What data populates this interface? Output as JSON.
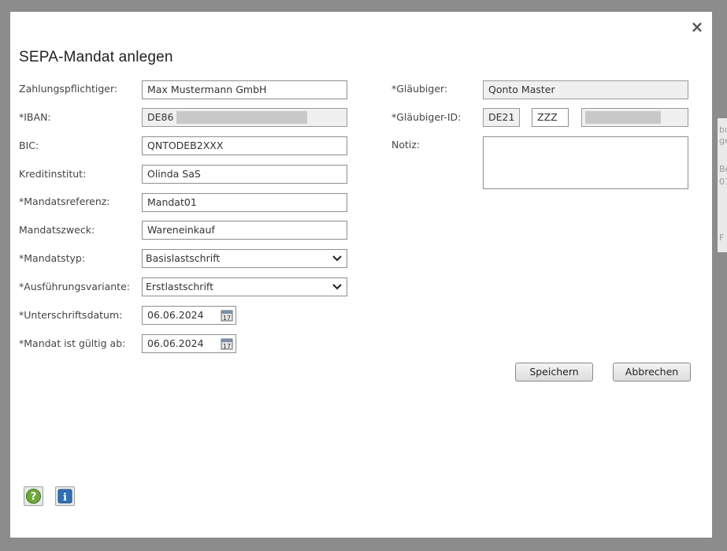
{
  "dialog": {
    "title": "SEPA-Mandat anlegen",
    "close_label": "×"
  },
  "left": {
    "payer_label": "Zahlungspflichtiger:",
    "payer_value": "Max Mustermann GmbH",
    "iban_label": "*IBAN:",
    "iban_prefix": "DE86",
    "bic_label": "BIC:",
    "bic_value": "QNTODEB2XXX",
    "bank_label": "Kreditinstitut:",
    "bank_value": "Olinda SaS",
    "mandate_ref_label": "*Mandatsreferenz:",
    "mandate_ref_value": "Mandat01",
    "purpose_label": "Mandatszweck:",
    "purpose_value": "Wareneinkauf",
    "type_label": "*Mandatstyp:",
    "type_value": "Basislastschrift",
    "variant_label": "*Ausführungsvariante:",
    "variant_value": "Erstlastschrift",
    "signature_date_label": "*Unterschriftsdatum:",
    "signature_date_value": "06.06.2024",
    "valid_from_label": "*Mandat ist gültig ab:",
    "valid_from_value": "06.06.2024"
  },
  "right": {
    "creditor_label": "*Gläubiger:",
    "creditor_value": "Qonto Master",
    "creditor_id_label": "*Gläubiger-ID:",
    "creditor_id_country": "DE21",
    "creditor_id_zzz": "ZZZ",
    "note_label": "Notiz:"
  },
  "actions": {
    "save_label": "Speichern",
    "cancel_label": "Abbrechen"
  },
  "footer": {
    "help_icon": "help-icon",
    "info_icon": "info-icon"
  },
  "background": {
    "fragments": [
      "bı",
      "ge",
      "Be",
      "01",
      "F"
    ]
  },
  "colors": {
    "overlay": "#8c8c8c",
    "readonly_bg": "#f0f0f0",
    "help_green": "#6fa83a",
    "info_blue": "#2f6fb5"
  }
}
